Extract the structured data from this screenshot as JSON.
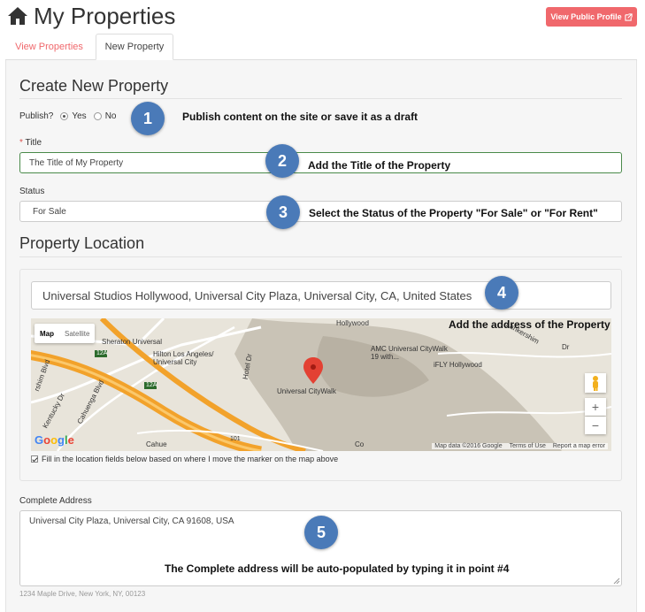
{
  "header": {
    "title": "My Properties",
    "home_icon": "home-icon",
    "profile_button": "View Public Profile",
    "profile_icon": "external-link-icon"
  },
  "tabs": [
    {
      "label": "View Properties"
    },
    {
      "label": "New Property"
    }
  ],
  "form": {
    "heading": "Create New Property",
    "publish": {
      "label": "Publish?",
      "yes": "Yes",
      "no": "No",
      "selected": "Yes"
    },
    "title": {
      "required_mark": "*",
      "label": "Title",
      "value": "The Title of My Property"
    },
    "status": {
      "label": "Status",
      "value": "For Sale"
    },
    "location_heading": "Property Location",
    "address_value": "Universal Studios Hollywood, Universal City Plaza, Universal City, CA, United States",
    "map": {
      "type_map": "Map",
      "type_satellite": "Satellite",
      "labels": [
        "Hollywood",
        "Sheraton Universal",
        "Hilton Los Angeles/ Universal City",
        "AMC Universal CityWalk 19 with...",
        "iFLY Hollywood",
        "Universal CityWalk",
        "Cahuenga Blvd",
        "Kentucky Dr",
        "Hotel Dr",
        "Cahue",
        "12A",
        "12A",
        "101",
        "rshim Blvd",
        "Lankershim",
        "Co",
        "Dr"
      ],
      "logo": "Google",
      "footer": [
        "Map data ©2016 Google",
        "Terms of Use",
        "Report a map error"
      ],
      "zoom_in": "+",
      "zoom_out": "−"
    },
    "marker_checkbox": "Fill in the location fields below based on where I move the marker on the map above",
    "complete_address": {
      "label": "Complete Address",
      "value": "Universal City Plaza, Universal City, CA 91608, USA",
      "help": "1234 Maple Drive, New York, NY, 00123"
    }
  },
  "annotations": [
    {
      "num": "1",
      "text": "Publish content on the site or save it as a draft"
    },
    {
      "num": "2",
      "text": "Add the Title of the Property"
    },
    {
      "num": "3",
      "text": "Select the Status of the Property \"For Sale\" or \"For Rent\""
    },
    {
      "num": "4",
      "text": "Add the address of the Property"
    },
    {
      "num": "5",
      "text": "The Complete address will be auto-populated by typing it in point #4"
    }
  ],
  "colors": {
    "accent": "#f0686c",
    "badge": "#4a7ab8"
  }
}
